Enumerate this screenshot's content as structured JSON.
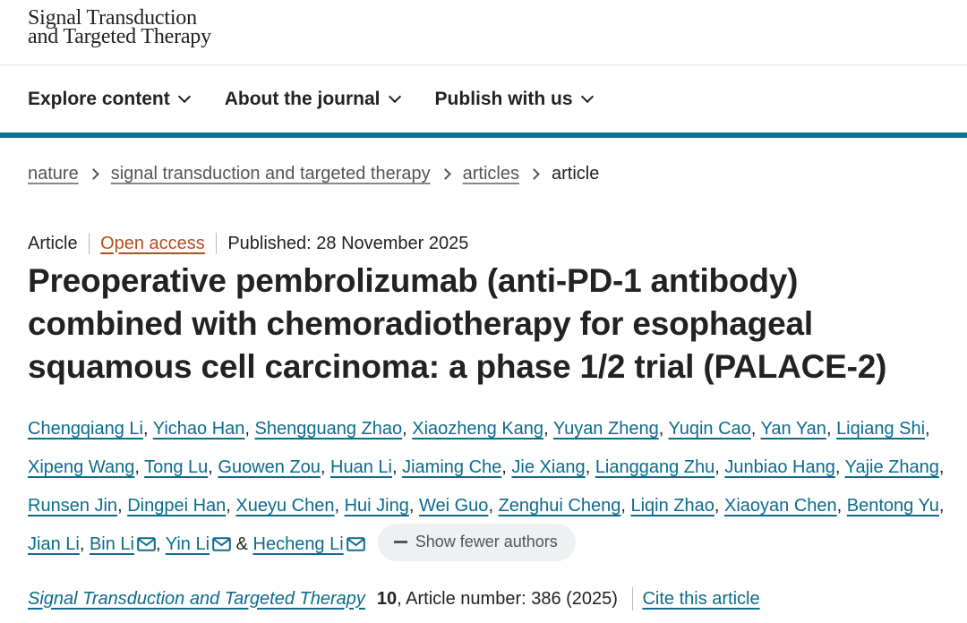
{
  "logo": {
    "line1": "Signal Transduction",
    "line2": "and Targeted Therapy"
  },
  "nav": {
    "items": [
      {
        "label": "Explore content"
      },
      {
        "label": "About the journal"
      },
      {
        "label": "Publish with us"
      }
    ]
  },
  "breadcrumb": {
    "items": [
      "nature",
      "signal transduction and targeted therapy",
      "articles"
    ],
    "current": "article"
  },
  "meta": {
    "type": "Article",
    "access": "Open access",
    "published": "Published: 28 November 2025"
  },
  "article": {
    "title": "Preoperative pembrolizumab (anti-PD-1 antibody) combined with chemoradiotherapy for esophageal squamous cell carcinoma: a phase 1/2 trial (PALACE-2)"
  },
  "authors": {
    "list": [
      "Chengqiang Li",
      "Yichao Han",
      "Shengguang Zhao",
      "Xiaozheng Kang",
      "Yuyan Zheng",
      "Yuqin Cao",
      "Yan Yan",
      "Liqiang Shi",
      "Xipeng Wang",
      "Tong Lu",
      "Guowen Zou",
      "Huan Li",
      "Jiaming Che",
      "Jie Xiang",
      "Lianggang Zhu",
      "Junbiao Hang",
      "Yajie Zhang",
      "Runsen Jin",
      "Dingpei Han",
      "Xueyu Chen",
      "Hui Jing",
      "Wei Guo",
      "Zenghui Cheng",
      "Liqin Zhao",
      "Xiaoyan Chen",
      "Bentong Yu",
      "Jian Li"
    ],
    "corresponding": [
      "Bin Li",
      "Yin Li",
      "Hecheng Li"
    ],
    "conjunction": "&",
    "toggle_label": "Show fewer authors"
  },
  "citation": {
    "journal": "Signal Transduction and Targeted Therapy",
    "volume": "10",
    "article_number": ", Article number: 386 (2025)",
    "cite_label": "Cite this article"
  },
  "colors": {
    "link": "#0c6b8e",
    "open_access": "#b14f1f",
    "nav_bar": "#0d7395",
    "toggle_bg": "#eef0f1"
  }
}
